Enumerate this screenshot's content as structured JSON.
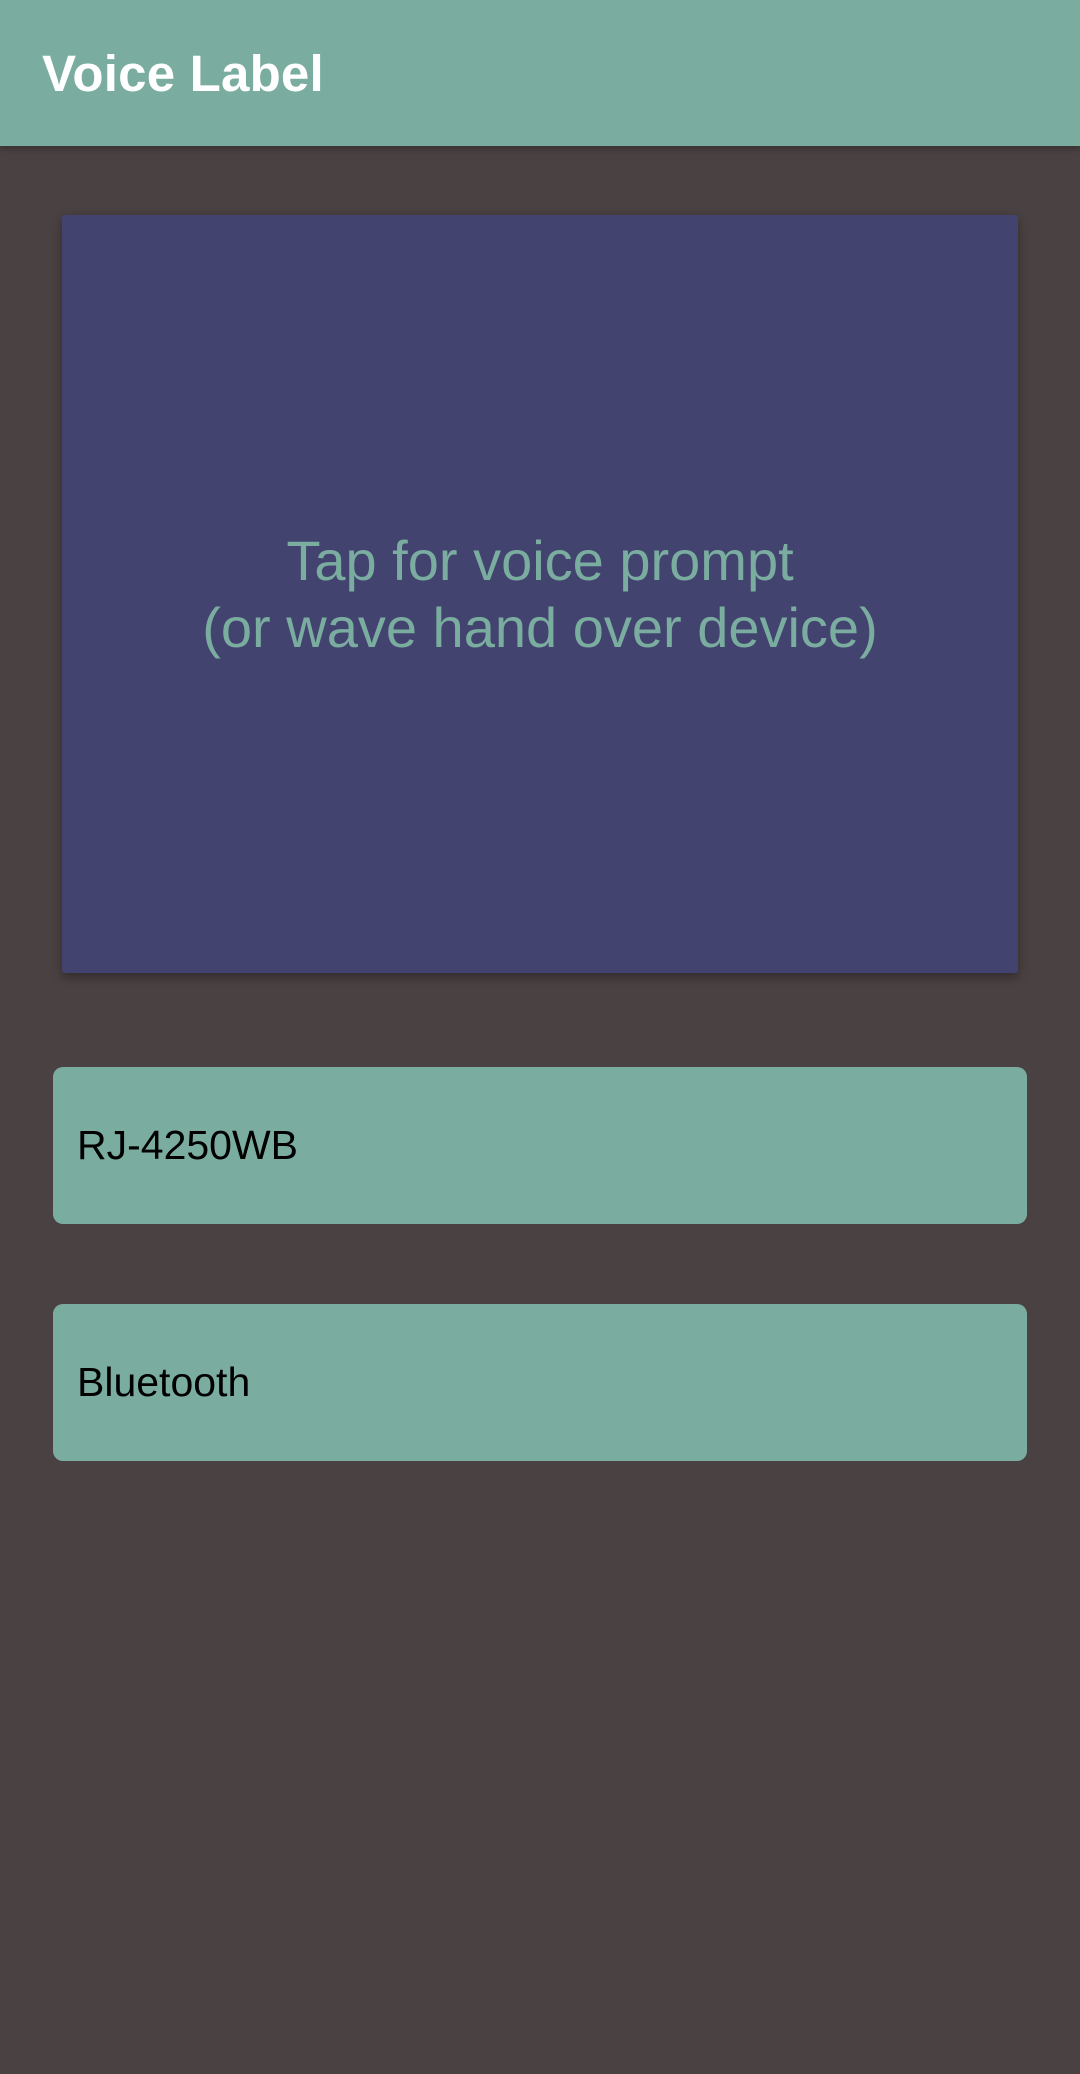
{
  "app_bar": {
    "title": "Voice Label"
  },
  "prompt_panel": {
    "line1": "Tap for voice prompt",
    "line2": "(or wave hand over device)"
  },
  "buttons": {
    "printer_label": "RJ-4250WB",
    "connection_label": "Bluetooth"
  },
  "colors": {
    "app_bar": "#7aada0",
    "background": "#4a4142",
    "prompt_panel": "#42436e",
    "prompt_text": "#7aada0",
    "button": "#7aada0"
  }
}
